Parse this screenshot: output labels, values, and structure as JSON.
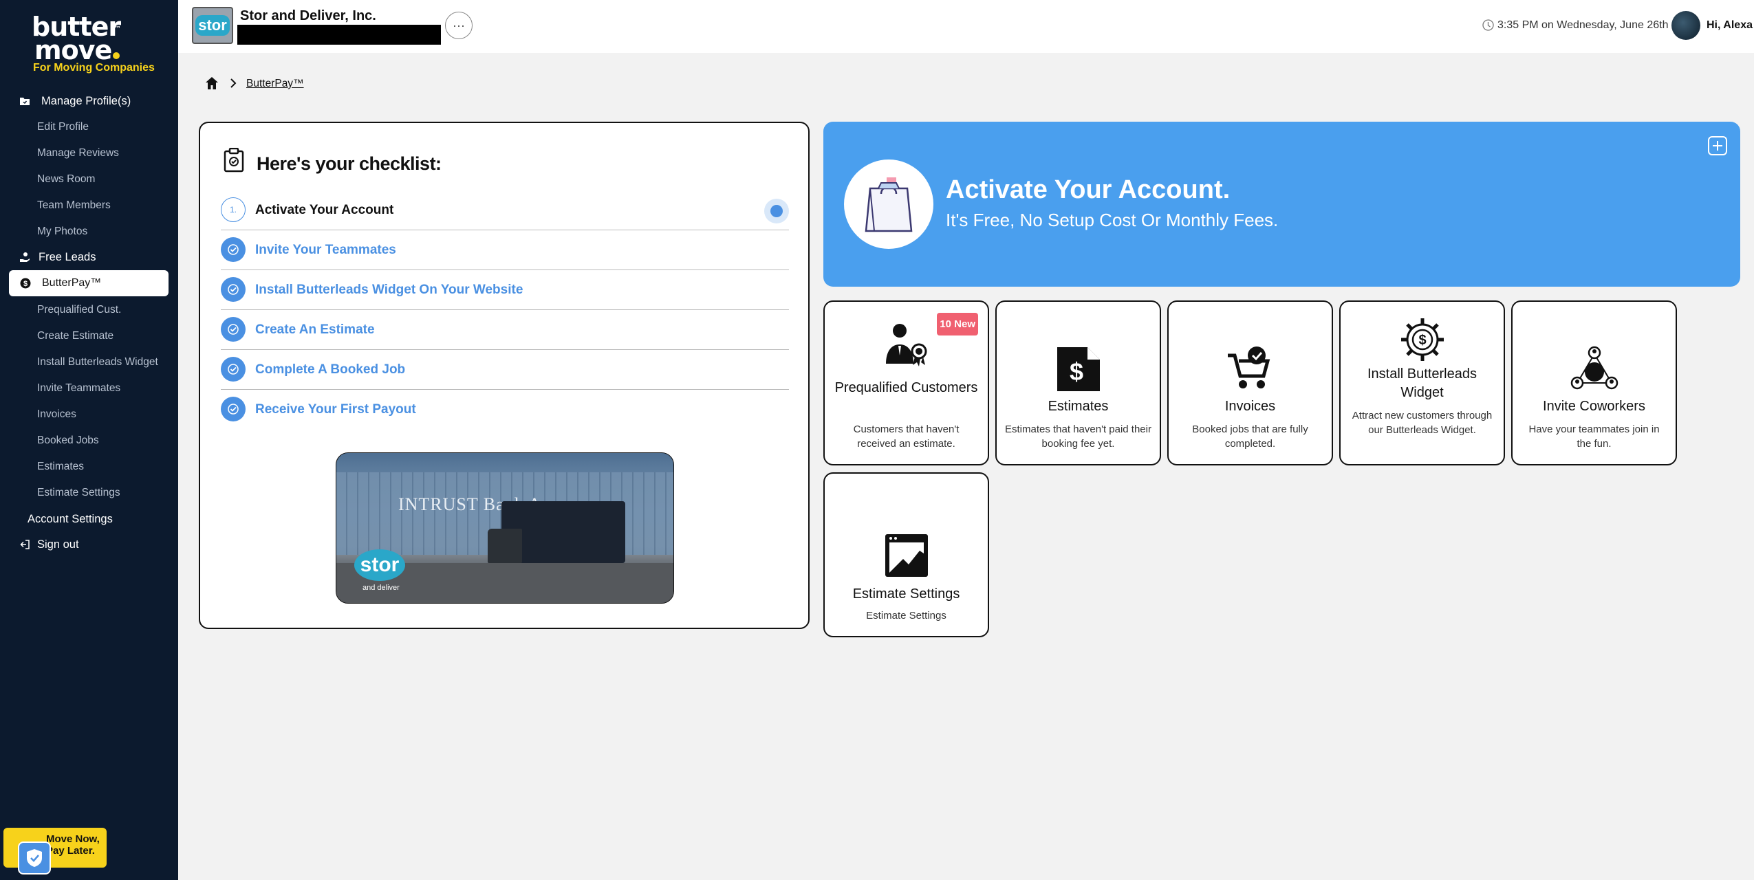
{
  "sidebar": {
    "logo_line1": "butter",
    "logo_line2": "move",
    "logo_tm": "™",
    "logo_sub": "For Moving Companies",
    "items": [
      {
        "label": "Manage Profile(s)"
      },
      {
        "label": "Edit Profile"
      },
      {
        "label": "Manage Reviews"
      },
      {
        "label": "News Room"
      },
      {
        "label": "Team Members"
      },
      {
        "label": "My Photos"
      },
      {
        "label": "Free Leads"
      },
      {
        "label": "ButterPay™"
      },
      {
        "label": "Prequalified Cust."
      },
      {
        "label": "Create Estimate"
      },
      {
        "label": "Install Butterleads Widget"
      },
      {
        "label": "Invite Teammates"
      },
      {
        "label": "Invoices"
      },
      {
        "label": "Booked Jobs"
      },
      {
        "label": "Estimates"
      },
      {
        "label": "Estimate Settings"
      },
      {
        "label": "Account Settings"
      },
      {
        "label": "Sign out"
      }
    ],
    "promo_line1": "Move Now,",
    "promo_line2": "Pay Later."
  },
  "header": {
    "company_logo_text": "stor",
    "company_name": "Stor and Deliver, Inc.",
    "more_label": "···",
    "datetime": "3:35 PM on Wednesday, June 26th",
    "greeting": "Hi, Alexa"
  },
  "breadcrumb": {
    "current": "ButterPay™"
  },
  "checklist": {
    "title": "Here's your checklist:",
    "first_step_number": "1.",
    "steps": [
      {
        "label": "Activate Your Account"
      },
      {
        "label": "Invite Your Teammates"
      },
      {
        "label": "Install Butterleads Widget On Your Website"
      },
      {
        "label": "Create An Estimate"
      },
      {
        "label": "Complete A Booked Job"
      },
      {
        "label": "Receive Your First Payout"
      }
    ],
    "photo": {
      "sign_text": "INTRUST Bank Arena",
      "logo_text": "stor",
      "logo_sub": "and deliver"
    }
  },
  "banner": {
    "title": "Activate Your Account.",
    "subtitle": "It's Free, No Setup Cost Or Monthly Fees."
  },
  "tiles": [
    {
      "name": "Prequalified Customers",
      "desc": "Customers that haven't received an estimate.",
      "badge": "10 New"
    },
    {
      "name": "Estimates",
      "desc": "Estimates that haven't paid their booking fee yet."
    },
    {
      "name": "Invoices",
      "desc": "Booked jobs that are fully completed."
    },
    {
      "name": "Install Butterleads Widget",
      "desc": "Attract new customers through our Butterleads Widget."
    },
    {
      "name": "Invite Coworkers",
      "desc": "Have your teammates join in the fun."
    },
    {
      "name": "Estimate Settings",
      "desc": "Estimate Settings"
    }
  ],
  "colors": {
    "sidebar_bg": "#0c1a2e",
    "accent_blue": "#4a9fee",
    "brand_yellow": "#f7d21b",
    "badge_red": "#f06070"
  }
}
